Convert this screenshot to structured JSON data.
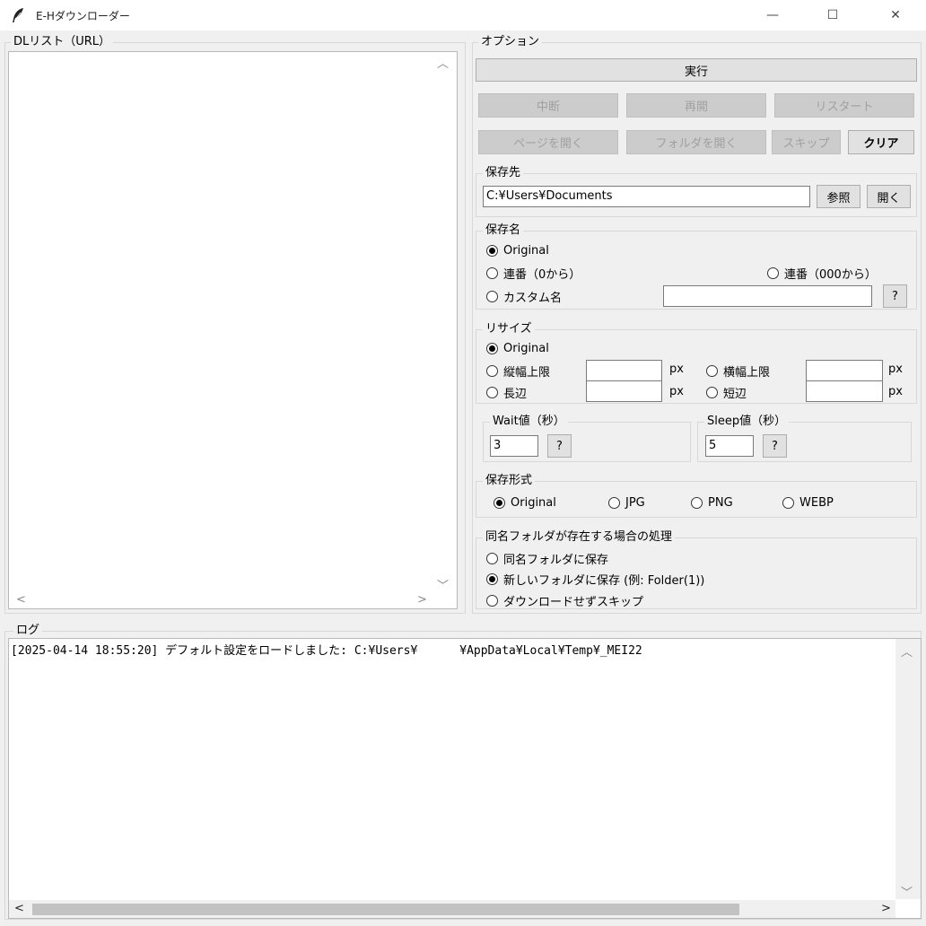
{
  "window": {
    "title": "E-Hダウンローダー",
    "minimize": "—",
    "maximize": "☐",
    "close": "✕"
  },
  "dl_list": {
    "label": "DLリスト（URL）",
    "arrow_up": "︿",
    "arrow_down": "﹀",
    "arrow_left": "<",
    "arrow_right": ">"
  },
  "options": {
    "label": "オプション",
    "run": "実行",
    "abort": "中断",
    "resume": "再開",
    "restart": "リスタート",
    "open_page": "ページを開く",
    "open_folder": "フォルダを開く",
    "skip": "スキップ",
    "clear": "クリア"
  },
  "save_dest": {
    "label": "保存先",
    "path": "C:¥Users¥Documents",
    "browse": "参照",
    "open": "開く"
  },
  "save_name": {
    "label": "保存名",
    "original": "Original",
    "serial0": "連番（0から）",
    "serial000": "連番（000から）",
    "custom": "カスタム名",
    "help": "?",
    "selected": "original"
  },
  "resize": {
    "label": "リサイズ",
    "original": "Original",
    "height_max": "縦幅上限",
    "width_max": "横幅上限",
    "long_side": "長辺",
    "short_side": "短辺",
    "unit": "px",
    "selected": "original"
  },
  "wait": {
    "label": "Wait値（秒）",
    "value": "3",
    "help": "?"
  },
  "sleep": {
    "label": "Sleep値（秒）",
    "value": "5",
    "help": "?"
  },
  "format": {
    "label": "保存形式",
    "original": "Original",
    "jpg": "JPG",
    "png": "PNG",
    "webp": "WEBP",
    "selected": "original"
  },
  "same_folder": {
    "label": "同名フォルダが存在する場合の処理",
    "save_same": "同名フォルダに保存",
    "save_new": "新しいフォルダに保存 (例: Folder(1))",
    "skip": "ダウンロードせずスキップ",
    "selected": "save_new"
  },
  "log": {
    "label": "ログ",
    "line1": "[2025-04-14 18:55:20] デフォルト設定をロードしました: C:¥Users¥      ¥AppData¥Local¥Temp¥_MEI22",
    "arrow_up": "︿",
    "arrow_down": "﹀",
    "arrow_left": "<",
    "arrow_right": ">"
  }
}
